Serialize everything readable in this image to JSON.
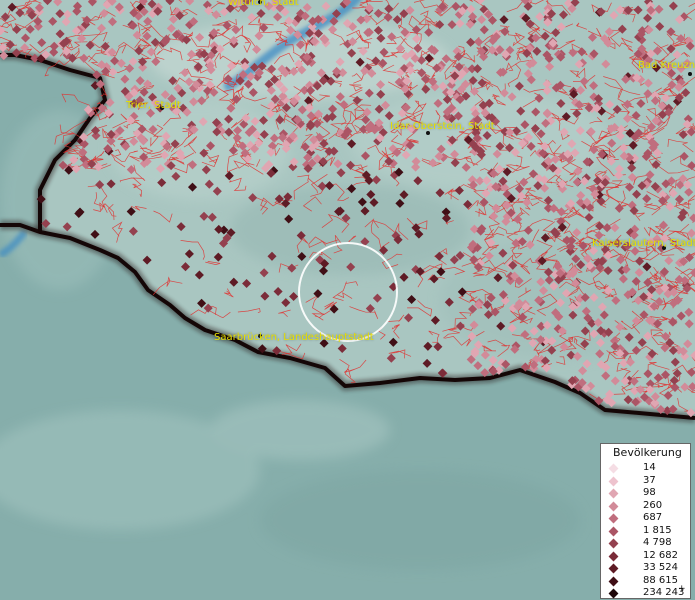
{
  "map": {
    "cities": [
      {
        "name": "Wittlich, Stadt"
      },
      {
        "name": "Trier, Stadt"
      },
      {
        "name": "Idar-Oberstein, Stadt"
      },
      {
        "name": "Bad Kreuzn"
      },
      {
        "name": "Kaiserslautern, Stadt"
      },
      {
        "name": "Saarbrücken, Landeshauptstadt"
      }
    ],
    "selection_circle": "Saarbrücken area highlight"
  },
  "legend": {
    "title": "Bevölkerung",
    "items": [
      {
        "label": "14",
        "color": "#f5dde4"
      },
      {
        "label": "37",
        "color": "#eec3ce"
      },
      {
        "label": "98",
        "color": "#e0a6b2"
      },
      {
        "label": "260",
        "color": "#d28b99"
      },
      {
        "label": "687",
        "color": "#c06e7e"
      },
      {
        "label": "1 815",
        "color": "#ab5565"
      },
      {
        "label": "4 798",
        "color": "#94414f"
      },
      {
        "label": "12 682",
        "color": "#7b2c39"
      },
      {
        "label": "33 524",
        "color": "#5e1b25"
      },
      {
        "label": "88 615",
        "color": "#400f16"
      },
      {
        "label": "234 243",
        "color": "#1e0508"
      }
    ],
    "overflow_marker": "+"
  }
}
